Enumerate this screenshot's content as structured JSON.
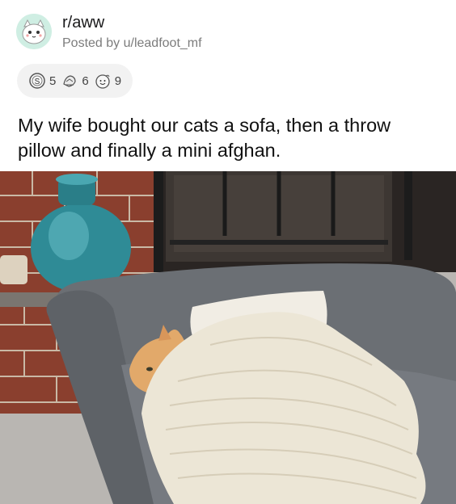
{
  "post": {
    "subreddit": "r/aww",
    "posted_by": "Posted by u/leadfoot_mf",
    "awards": [
      {
        "icon": "silver-award-icon",
        "count": "5"
      },
      {
        "icon": "helpful-award-icon",
        "count": "6"
      },
      {
        "icon": "wholesome-award-icon",
        "count": "9"
      }
    ],
    "title": "My wife bought our cats a sofa, then a throw pillow and finally a mini afghan."
  },
  "colors": {
    "avatar_bg": "#cfeee3",
    "award_pill_bg": "#f2f2f2",
    "title_text": "#111111",
    "meta_text": "#7c7c7c",
    "chair": "#6b6f74",
    "blanket": "#ece6d6",
    "cat": "#e2a96a"
  },
  "image": {
    "subject": "cat-under-crochet-blanket-photo"
  }
}
